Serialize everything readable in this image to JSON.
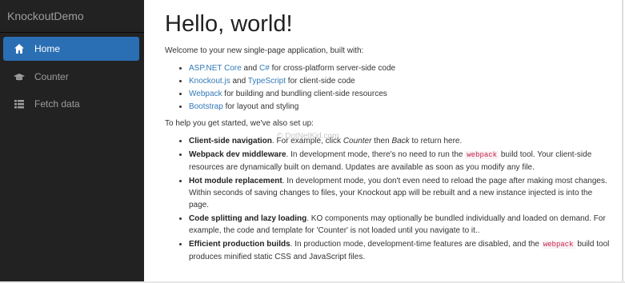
{
  "sidebar": {
    "brand": "KnockoutDemo",
    "items": [
      {
        "label": "Home",
        "icon": "home-icon"
      },
      {
        "label": "Counter",
        "icon": "graduation-cap-icon"
      },
      {
        "label": "Fetch data",
        "icon": "list-icon"
      }
    ],
    "active_color": "#2a6fb4",
    "background": "#222222"
  },
  "main": {
    "title": "Hello, world!",
    "intro": "Welcome to your new single-page application, built with:",
    "tech": [
      {
        "link1": "ASP.NET Core",
        "mid": " and ",
        "link2": "C#",
        "rest": " for cross-platform server-side code"
      },
      {
        "link1": "Knockout.js",
        "mid": " and ",
        "link2": "TypeScript",
        "rest": " for client-side code"
      },
      {
        "link1": "Webpack",
        "rest": " for building and bundling client-side resources"
      },
      {
        "link1": "Bootstrap",
        "rest": " for layout and styling"
      }
    ],
    "setup_intro": "To help you get started, we've also set up:",
    "features": [
      {
        "title": "Client-side navigation",
        "text_a": ". For example, click ",
        "em1": "Counter",
        "text_b": " then ",
        "em2": "Back",
        "text_c": " to return here."
      },
      {
        "title": "Webpack dev middleware",
        "text_a": ". In development mode, there's no need to run the ",
        "code": "webpack",
        "text_b": " build tool. Your client-side resources are dynamically built on demand. Updates are available as soon as you modify any file."
      },
      {
        "title": "Hot module replacement",
        "text_a": ". In development mode, you don't even need to reload the page after making most changes. Within seconds of saving changes to files, your Knockout app will be rebuilt and a new instance injected is into the page."
      },
      {
        "title": "Code splitting and lazy loading",
        "text_a": ". KO components may optionally be bundled individually and loaded on demand. For example, the code and template for 'Counter' is not loaded until you navigate to it.."
      },
      {
        "title": "Efficient production builds",
        "text_a": ". In production mode, development-time features are disabled, and the ",
        "code": "webpack",
        "text_b": " build tool produces minified static CSS and JavaScript files."
      }
    ]
  },
  "watermark": "© DotNetKid.com"
}
